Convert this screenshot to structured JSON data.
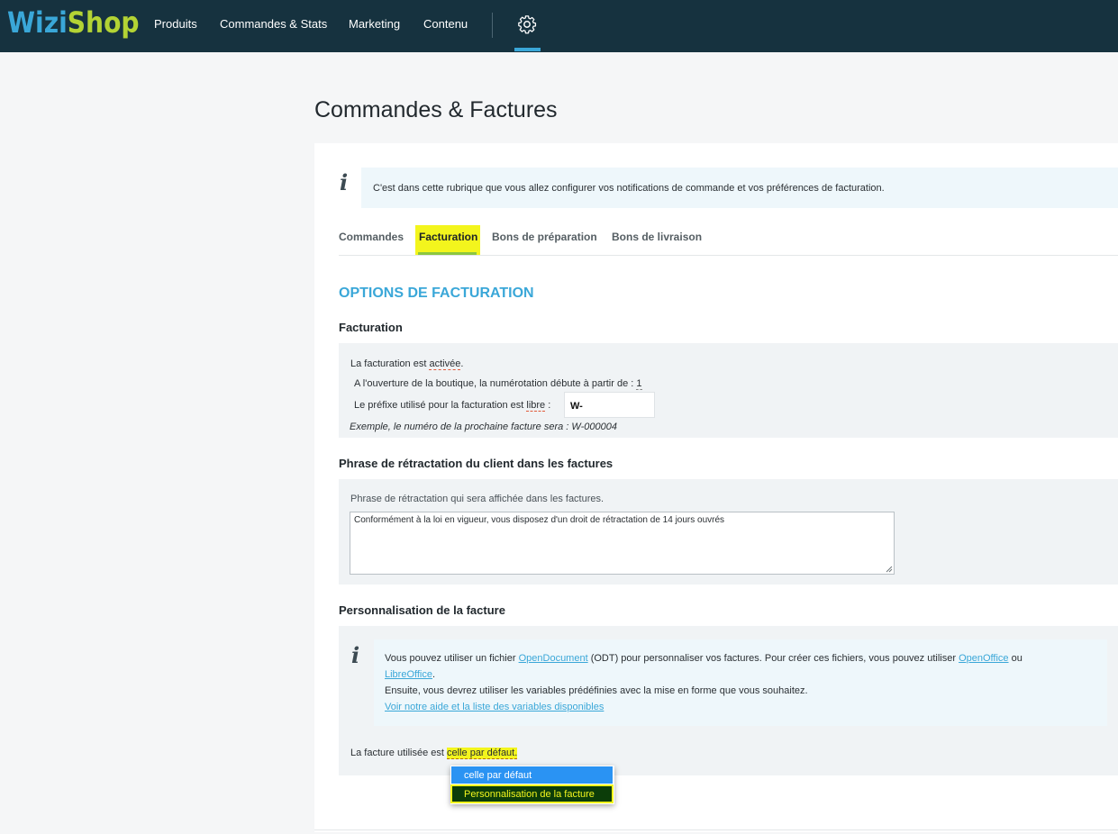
{
  "brand": {
    "logo_part1": "Wizi",
    "logo_part2": "Shop"
  },
  "nav": {
    "items": [
      "Produits",
      "Commandes & Stats",
      "Marketing",
      "Contenu"
    ],
    "settings_icon": "gear-icon"
  },
  "page": {
    "title": "Commandes & Factures"
  },
  "intro": {
    "text": "C'est dans cette rubrique que vous allez configurer vos notifications de commande et vos préférences de facturation."
  },
  "tabs": [
    {
      "label": "Commandes",
      "active": false
    },
    {
      "label": "Facturation",
      "active": true
    },
    {
      "label": "Bons de préparation",
      "active": false
    },
    {
      "label": "Bons de livraison",
      "active": false
    }
  ],
  "section": {
    "title": "OPTIONS DE FACTURATION"
  },
  "facturation": {
    "heading": "Facturation",
    "line1_prefix": "La facturation est ",
    "line1_value": "activée",
    "line1_suffix": ".",
    "line2_prefix": "A l'ouverture de la boutique, la numérotation débute à partir de : ",
    "line2_value": "1",
    "line3_prefix": "Le préfixe utilisé pour la facturation est ",
    "line3_value": "libre",
    "line3_suffix": " :",
    "prefix_value": "W-",
    "example": "Exemple, le numéro de la prochaine facture sera : W-000004"
  },
  "retractation": {
    "heading": "Phrase de rétractation du client dans les factures",
    "label": "Phrase de rétractation qui sera affichée dans les factures.",
    "value": "Conformément à la loi en vigueur, vous disposez d'un droit de rétractation de 14 jours ouvrés"
  },
  "personnalisation": {
    "heading": "Personnalisation de la facture",
    "info": {
      "p1_a": "Vous pouvez utiliser un fichier ",
      "p1_link1": "OpenDocument",
      "p1_b": " (ODT) pour personnaliser vos factures. Pour créer ces fichiers, vous pouvez utiliser ",
      "p1_link2": "OpenOffice",
      "p1_c": " ou",
      "p2_link": "LibreOffice",
      "p2_end": ".",
      "p3": "Ensuite, vous devrez utiliser les variables prédéfinies avec la mise en forme que vous souhaitez.",
      "p4_link": "Voir notre aide et la liste des variables disponibles"
    },
    "used_prefix": "La facture utilisée est ",
    "used_value": "celle par défaut.",
    "dropdown_options": [
      "celle par défaut",
      "Personnalisation de la facture"
    ]
  },
  "colors": {
    "topbar": "#16323f",
    "accent": "#3aa7d8",
    "highlight": "#f3f51d",
    "dropdown_selected": "#2a93f3"
  }
}
